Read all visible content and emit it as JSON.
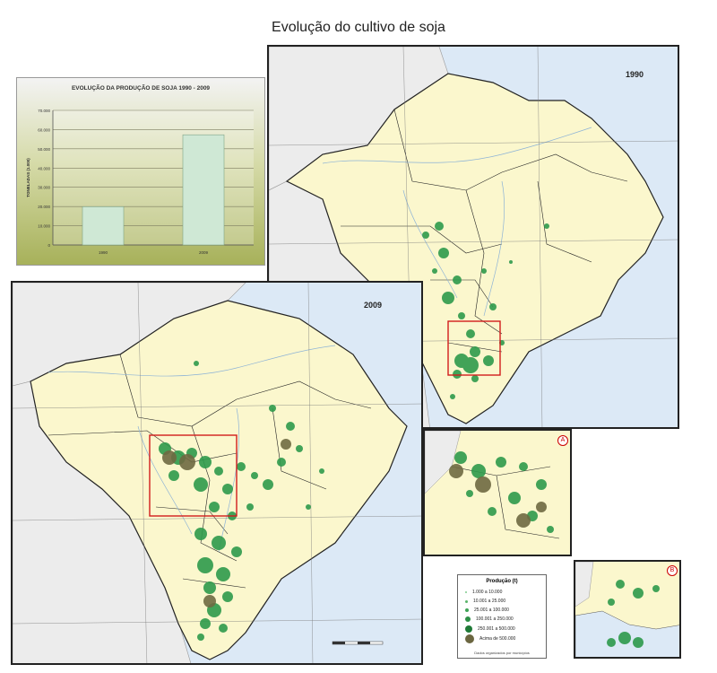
{
  "page": {
    "title": "Evolução do cultivo de soja"
  },
  "chart_data": {
    "type": "bar",
    "title": "EVOLUÇÃO DA PRODUÇÃO DE SOJA 1990 - 2009",
    "ylabel": "TONELADAS (1.000)",
    "xlabel": "",
    "categories": [
      "1990",
      "2009"
    ],
    "values": [
      19900,
      57300
    ],
    "ylim": [
      0,
      70000
    ],
    "yticks": [
      "0",
      "10.000",
      "20.000",
      "30.000",
      "40.000",
      "50.000",
      "60.000",
      "70.000"
    ],
    "grid": true,
    "colors": {
      "bar": "#cfe8d5",
      "bar_edge": "#7fa386"
    }
  },
  "maps": {
    "map1990": {
      "year": "1990"
    },
    "map2009": {
      "year": "2009"
    },
    "insetA": {
      "letter": "A"
    },
    "insetB": {
      "letter": "B"
    }
  },
  "legend": {
    "title": "Produção (t)",
    "items": [
      {
        "label": "1.000 a 10.000",
        "size": 2,
        "color": "#7ecb8c"
      },
      {
        "label": "10.001 a 25.000",
        "size": 3,
        "color": "#5ab46a"
      },
      {
        "label": "25.001 a 100.000",
        "size": 4,
        "color": "#3fa356"
      },
      {
        "label": "100.001 a 250.000",
        "size": 6,
        "color": "#2d8f46"
      },
      {
        "label": "250.001 a 500.000",
        "size": 8,
        "color": "#1f7a37"
      },
      {
        "label": "Acima de 500.000",
        "size": 10,
        "color": "#6b6640"
      }
    ],
    "note": "Dados organizados por municípios"
  },
  "colors": {
    "land": "#fbf7cd",
    "ocean": "#dce9f6",
    "neighbor": "#ececec",
    "border": "#222222",
    "soy_dot": "#2e9a4c",
    "soy_big": "#6f6a42",
    "highlight": "#d11c1c"
  }
}
